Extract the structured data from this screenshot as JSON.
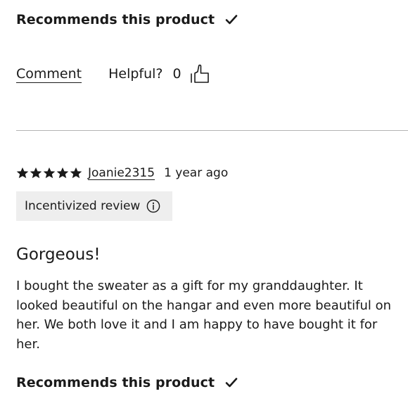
{
  "previous_review": {
    "recommends_label": "Recommends this product",
    "comment_label": "Comment",
    "helpful_label": "Helpful?",
    "helpful_count": "0"
  },
  "review": {
    "rating": 5,
    "star_glyph_count": 5,
    "author": "Joanie2315",
    "date": "1 year ago",
    "badge_label": "Incentivized review",
    "title": "Gorgeous!",
    "body": "I bought the sweater as a gift for my granddaughter. It looked beautiful on the hangar and even more beautiful on her. We both love it and I am happy to have bought it for her.",
    "recommends_label": "Recommends this product"
  },
  "icons": {
    "check": "check-icon",
    "thumbs_up": "thumbs-up-icon",
    "star": "star-icon",
    "info": "info-icon"
  },
  "colors": {
    "text": "#1a1a1a",
    "divider": "#b3b3b3",
    "badge_bg": "#eeeeee"
  }
}
